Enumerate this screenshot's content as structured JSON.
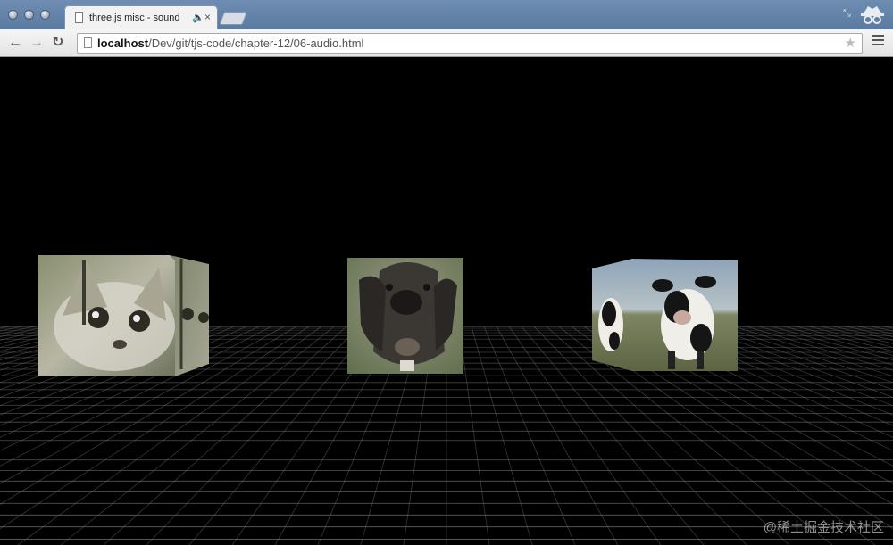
{
  "browser": {
    "tab_title": "three.js misc - sound",
    "tab_sound_icon": "speaker-icon",
    "tab_close": "×",
    "url_host": "localhost",
    "url_path": "/Dev/git/tjs-code/chapter-12/06-audio.html",
    "back": "←",
    "forward": "→",
    "reload": "↻",
    "star": "★"
  },
  "scene": {
    "objects": [
      {
        "name": "cat-cube",
        "texture": "cat"
      },
      {
        "name": "dog-cube",
        "texture": "dog"
      },
      {
        "name": "cow-cube",
        "texture": "cow"
      }
    ]
  },
  "watermark": "@稀土掘金技术社区"
}
